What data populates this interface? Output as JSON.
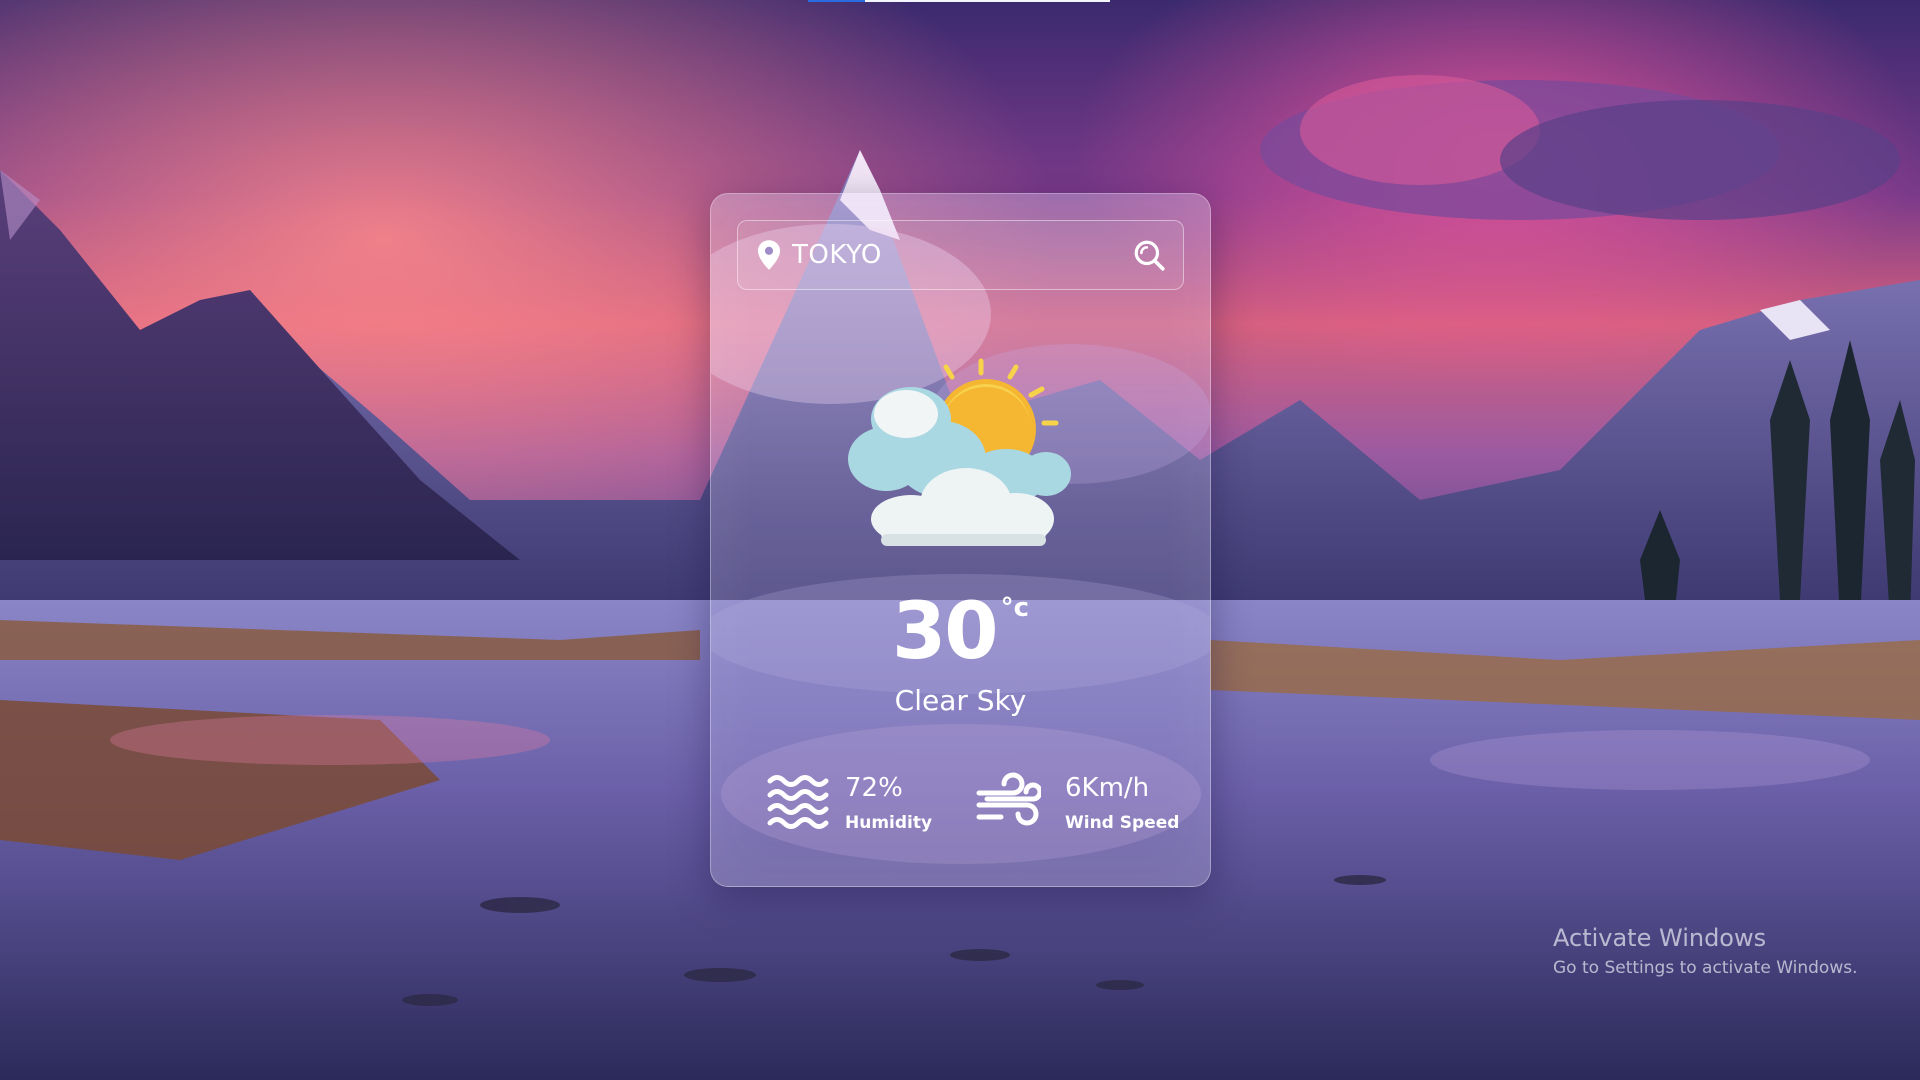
{
  "top_progress": {
    "value_percent": 19,
    "colors": {
      "fill": "#2a6be0",
      "track": "#f4f6ff"
    }
  },
  "search": {
    "pin_icon": "location-pin-icon",
    "city_value": "TOKYO",
    "search_icon": "search-icon"
  },
  "weather": {
    "icon": "partly-cloudy-sun-icon",
    "temperature": "30",
    "unit": "°c",
    "description": "Clear Sky"
  },
  "stats": {
    "humidity": {
      "icon": "humidity-waves-icon",
      "value": "72%",
      "label": "Humidity"
    },
    "wind": {
      "icon": "wind-icon",
      "value": "6Km/h",
      "label": "Wind Speed"
    }
  },
  "windows_watermark": {
    "title": "Activate Windows",
    "subtitle": "Go to Settings to activate Windows."
  }
}
